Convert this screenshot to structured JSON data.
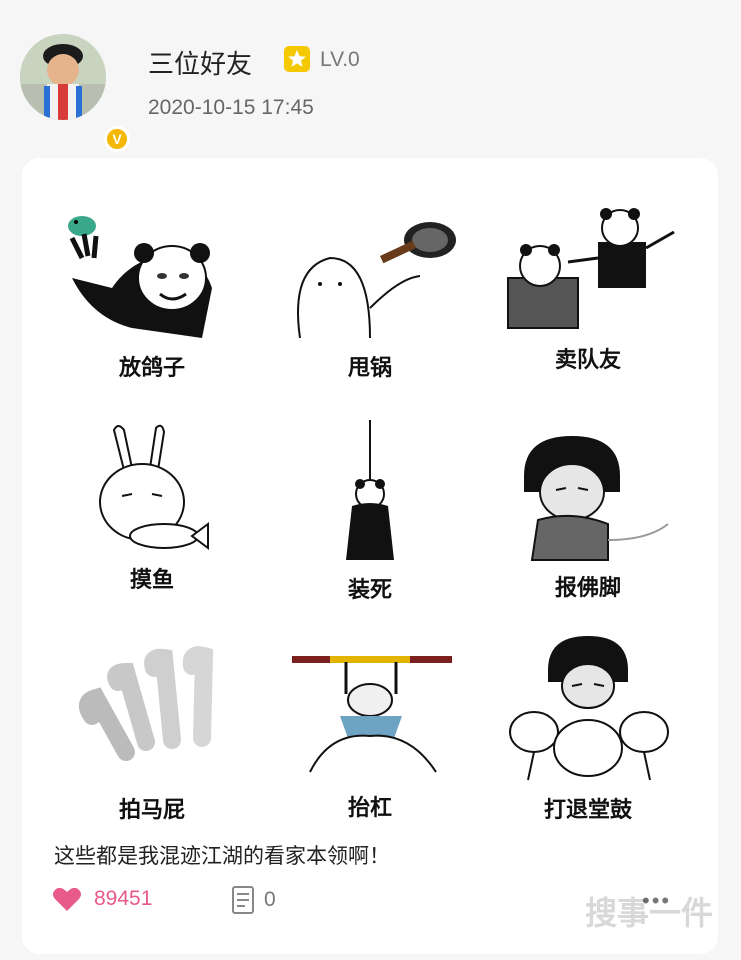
{
  "post": {
    "author": "三位好友",
    "level": "LV.0",
    "timestamp": "2020-10-15 17:45"
  },
  "meme_grid": [
    {
      "label": "放鸽子"
    },
    {
      "label": "甩锅"
    },
    {
      "label": "卖队友"
    },
    {
      "label": "摸鱼"
    },
    {
      "label": "装死"
    },
    {
      "label": "报佛脚"
    },
    {
      "label": "拍马屁"
    },
    {
      "label": "抬杠"
    },
    {
      "label": "打退堂鼓"
    }
  ],
  "caption": "这些都是我混迹江湖的看家本领啊！",
  "actions": {
    "likes": "89451",
    "comments": "0"
  },
  "watermark": "搜事一件",
  "colors": {
    "accent_pink": "#e85a8a",
    "badge_yellow": "#f5b800"
  }
}
